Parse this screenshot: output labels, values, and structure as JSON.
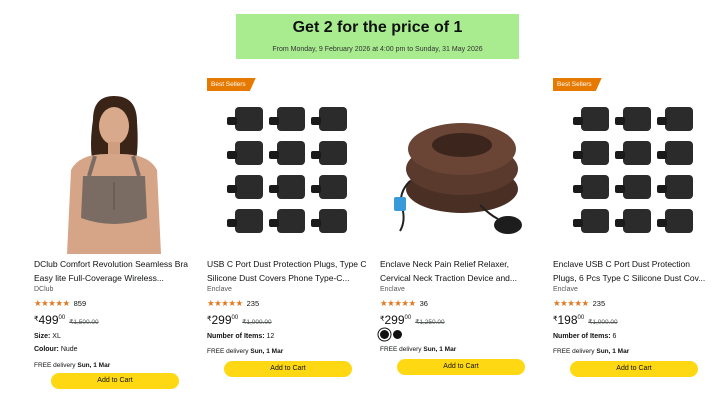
{
  "promo": {
    "title": "Get 2 for the price of 1",
    "subtitle": "From Monday, 9 February 2026 at 4:00 pm to Sunday, 31 May 2026"
  },
  "colors": {
    "banner": "#a8ec8f",
    "badge": "#e67a00",
    "button": "#ffd814",
    "stars": "#de7921"
  },
  "products": [
    {
      "badge": "",
      "image": "woman-wearing-bra-photo",
      "title": "DClub Comfort Revolution Seamless Bra Easy lite Full-Coverage Wireless...",
      "brand": "DClub",
      "stars": "★★★★★",
      "rating_value": 4.5,
      "reviews": "859",
      "currency": "₹",
      "price": "499",
      "price_frac": "00",
      "mrp": "₹1,500.00",
      "attr1_label": "Size:",
      "attr1_value": "XL",
      "attr2_label": "Colour:",
      "attr2_value": "Nude",
      "delivery_prefix": "FREE delivery",
      "delivery_date": "Sun, 1 Mar",
      "button": "Add to Cart"
    },
    {
      "badge": "Best Sellers",
      "image": "dust-plugs-grid-photo",
      "title": "USB C Port Dust Protection Plugs, Type C Silicone Dust Covers Phone Type-C...",
      "brand": "Enclave",
      "stars": "★★★★★",
      "rating_value": 4.5,
      "reviews": "235",
      "currency": "₹",
      "price": "299",
      "price_frac": "00",
      "mrp": "₹1,000.00",
      "attr1_label": "Number of Items:",
      "attr1_value": "12",
      "delivery_prefix": "FREE delivery",
      "delivery_date": "Sun, 1 Mar",
      "button": "Add to Cart"
    },
    {
      "badge": "",
      "image": "neck-traction-device-photo",
      "title": "Enclave Neck Pain Relief Relaxer, Cervical Neck Traction Device and...",
      "brand": "Enclave",
      "stars": "★★★★★",
      "rating_value": 4.5,
      "reviews": "36",
      "currency": "₹",
      "price": "299",
      "price_frac": "00",
      "mrp": "₹1,250.00",
      "swatches": [
        "#1a1a1a",
        "#1a1a1a"
      ],
      "delivery_prefix": "FREE delivery",
      "delivery_date": "Sun, 1 Mar",
      "button": "Add to Cart"
    },
    {
      "badge": "Best Sellers",
      "image": "dust-plugs-grid-photo",
      "title": "Enclave USB C Port Dust Protection Plugs, 6 Pcs Type C Silicone Dust Cov...",
      "brand": "Enclave",
      "stars": "★★★★★",
      "rating_value": 4.5,
      "reviews": "235",
      "currency": "₹",
      "price": "198",
      "price_frac": "00",
      "mrp": "₹1,000.00",
      "attr1_label": "Number of Items:",
      "attr1_value": "6",
      "delivery_prefix": "FREE delivery",
      "delivery_date": "Sun, 1 Mar",
      "button": "Add to Cart"
    }
  ]
}
